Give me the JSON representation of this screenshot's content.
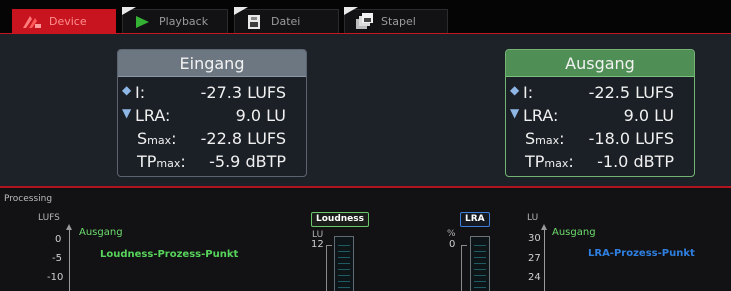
{
  "tabs": [
    {
      "label": "Device",
      "icon": "device-wave-icon",
      "active": true
    },
    {
      "label": "Playback",
      "icon": "play-icon",
      "active": false
    },
    {
      "label": "Datei",
      "icon": "file-icon",
      "active": false
    },
    {
      "label": "Stapel",
      "icon": "stack-icon",
      "active": false
    }
  ],
  "eingang": {
    "title": "Eingang",
    "i_label": "I:",
    "i_value": "-27.3 LUFS",
    "lra_label": "LRA:",
    "lra_value": "9.0 LU",
    "smax_label": "S",
    "smax_sub": "max",
    "smax_colon": ":",
    "smax_value": "-22.8 LUFS",
    "tpmax_label": "TP",
    "tpmax_sub": "max",
    "tpmax_colon": ":",
    "tpmax_value": "-5.9 dBTP"
  },
  "ausgang": {
    "title": "Ausgang",
    "i_label": "I:",
    "i_value": "-22.5 LUFS",
    "lra_label": "LRA:",
    "lra_value": "9.0 LU",
    "smax_label": "S",
    "smax_sub": "max",
    "smax_colon": ":",
    "smax_value": "-18.0 LUFS",
    "tpmax_label": "TP",
    "tpmax_sub": "max",
    "tpmax_colon": ":",
    "tpmax_value": "-1.0 dBTP"
  },
  "processing": {
    "title": "Processing",
    "left_axis_unit": "LUFS",
    "left_ticks": [
      "0",
      "-5",
      "-10"
    ],
    "left_series_label": "Ausgang",
    "left_point_label": "Loudness-Prozess-Punkt",
    "loudness_badge": "Loudness",
    "loudness_unit": "LU",
    "loudness_tick": "12",
    "lra_badge": "LRA",
    "lra_unit": "%",
    "lra_tick": "0",
    "right_axis_unit": "LU",
    "right_ticks": [
      "30",
      "27",
      "24"
    ],
    "right_series_label": "Ausgang",
    "right_point_label": "LRA-Prozess-Punkt"
  },
  "colors": {
    "accent_red": "#c8141e",
    "input_header": "#6d7782",
    "output_header": "#4f8f55",
    "loudness_green": "#57d35b",
    "lra_blue": "#2f7fe0"
  }
}
